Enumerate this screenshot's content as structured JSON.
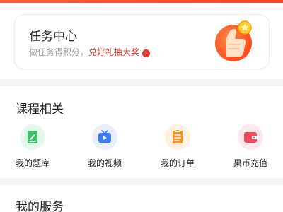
{
  "task_center": {
    "title": "任务中心",
    "subtitle_gray": "做任务得积分，",
    "subtitle_red": "兑好礼抽大奖"
  },
  "course_section": {
    "title": "课程相关",
    "items": [
      {
        "label": "我的题库",
        "icon": "question-bank-icon",
        "color": "#3cc46a",
        "bg": "#e6f8ec"
      },
      {
        "label": "我的视频",
        "icon": "video-icon",
        "color": "#3f7cf4",
        "bg": "#e8efff"
      },
      {
        "label": "我的订单",
        "icon": "order-icon",
        "color": "#f7931e",
        "bg": "#fff0e0"
      },
      {
        "label": "果币充值",
        "icon": "wallet-icon",
        "color": "#f24a5a",
        "bg": "#ffe7ea"
      }
    ]
  },
  "services_section": {
    "title": "我的服务"
  },
  "colors": {
    "accent_red": "#e1362b",
    "top_strip": "#f0472f"
  }
}
